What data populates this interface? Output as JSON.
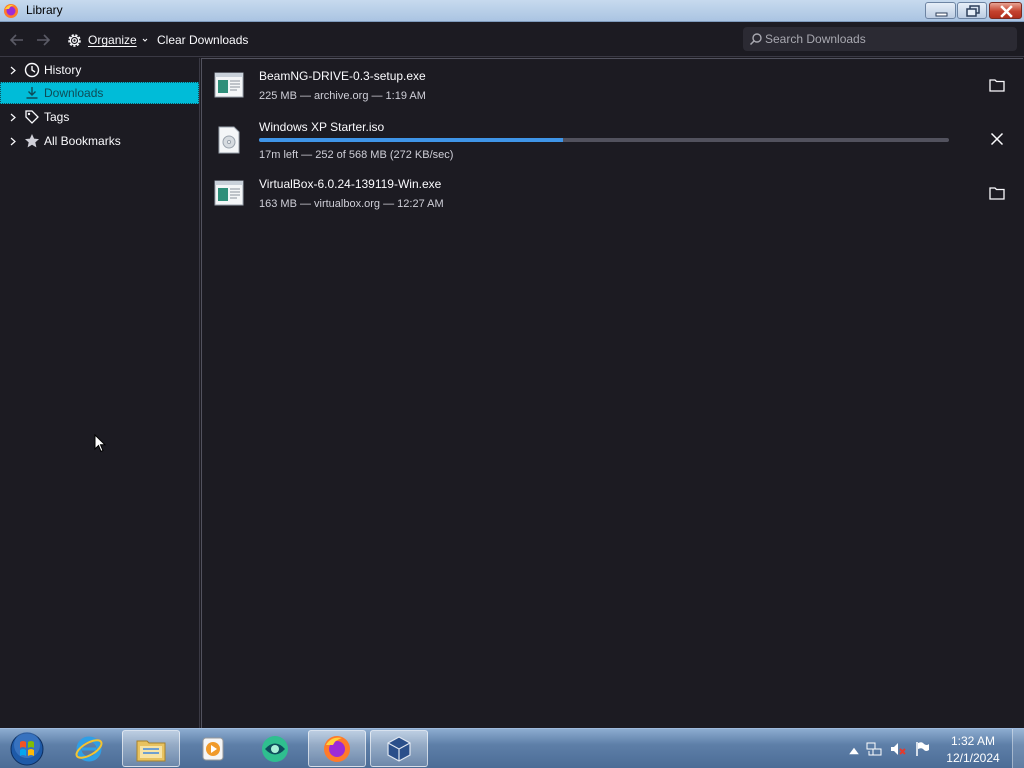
{
  "window": {
    "title": "Library"
  },
  "toolbar": {
    "organize_label": "Organize",
    "clear_label": "Clear Downloads",
    "search_placeholder": "Search Downloads"
  },
  "sidebar": {
    "items": [
      {
        "label": "History",
        "icon": "clock-icon"
      },
      {
        "label": "Downloads",
        "icon": "download-icon",
        "selected": true
      },
      {
        "label": "Tags",
        "icon": "tag-icon"
      },
      {
        "label": "All Bookmarks",
        "icon": "star-icon"
      }
    ]
  },
  "downloads": [
    {
      "name": "BeamNG-DRIVE-0.3-setup.exe",
      "status": "225 MB — archive.org — 1:19 AM",
      "action": "folder-icon"
    },
    {
      "name": "Windows XP Starter.iso",
      "status": "17m left — 252 of 568 MB (272 KB/sec)",
      "action": "close-icon",
      "progress": 0.44
    },
    {
      "name": "VirtualBox-6.0.24-139119-Win.exe",
      "status": "163 MB — virtualbox.org — 12:27 AM",
      "action": "folder-icon"
    }
  ],
  "taskbar": {
    "apps": [
      "internet-explorer-icon",
      "file-explorer-icon",
      "media-player-icon",
      "green-app-icon",
      "firefox-icon",
      "virtualbox-icon"
    ],
    "clock": {
      "time": "1:32 AM",
      "date": "12/1/2024"
    }
  },
  "colors": {
    "background": "#1c1b22",
    "selection": "#00bcd8",
    "progress": "#3f95e8"
  }
}
